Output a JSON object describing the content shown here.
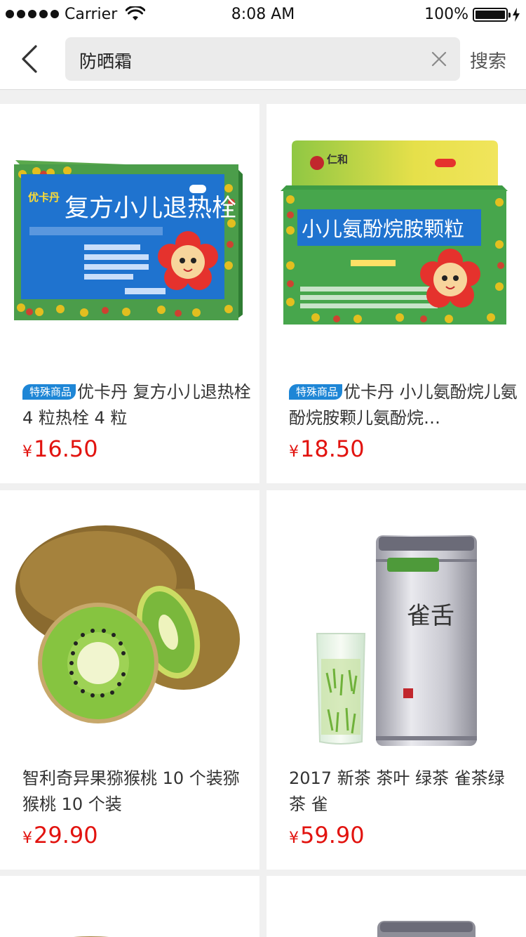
{
  "status_bar": {
    "carrier": "Carrier",
    "time": "8:08 AM",
    "battery": "100%"
  },
  "header": {
    "search_value": "防晒霜",
    "search_button": "搜索"
  },
  "products": [
    {
      "tag": "特殊商品",
      "title": "优卡丹 复方小儿退热栓 4 粒热栓 4 粒",
      "currency": "¥",
      "price": "16.50",
      "box_text": "复方小儿退热栓",
      "brand": "优卡丹"
    },
    {
      "tag": "特殊商品",
      "title": "优卡丹  小儿氨酚烷儿氨酚烷胺颗儿氨酚烷…",
      "currency": "¥",
      "price": "18.50",
      "box_text": "小儿氨酚烷胺颗粒",
      "brand": "仁和"
    },
    {
      "tag": "",
      "title": "智利奇异果猕猴桃 10 个装猕猴桃 10 个装",
      "currency": "¥",
      "price": "29.90"
    },
    {
      "tag": "",
      "title": "2017 新茶 茶叶 绿茶 雀茶绿茶 雀",
      "currency": "¥",
      "price": "59.90",
      "can_text": "雀舌"
    }
  ],
  "colors": {
    "price": "#e2130f",
    "tag": "#1e86d6"
  }
}
